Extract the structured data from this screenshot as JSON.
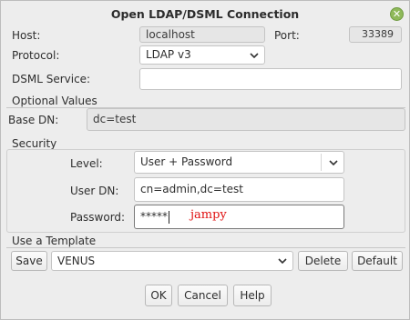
{
  "window": {
    "title": "Open LDAP/DSML Connection",
    "close_glyph": "✕"
  },
  "connection": {
    "host_label": "Host:",
    "host_value": "localhost",
    "port_label": "Port:",
    "port_value": "33389",
    "protocol_label": "Protocol:",
    "protocol_value": "LDAP v3",
    "dsml_label": "DSML Service:",
    "dsml_value": ""
  },
  "optional": {
    "section_label": "Optional Values",
    "basedn_label": "Base DN:",
    "basedn_value": "dc=test"
  },
  "security": {
    "section_label": "Security",
    "level_label": "Level:",
    "level_value": "User + Password",
    "userdn_label": "User DN:",
    "userdn_value": "cn=admin,dc=test",
    "password_label": "Password:",
    "password_value": "*****"
  },
  "annotation": {
    "text": "jampy",
    "color": "#e01010"
  },
  "template": {
    "section_label": "Use a Template",
    "save_label": "Save",
    "template_value": "VENUS",
    "delete_label": "Delete",
    "default_label": "Default"
  },
  "footer": {
    "ok_label": "OK",
    "cancel_label": "Cancel",
    "help_label": "Help"
  },
  "icons": {
    "dropdown": "chevron-down-icon",
    "close": "close-icon"
  }
}
